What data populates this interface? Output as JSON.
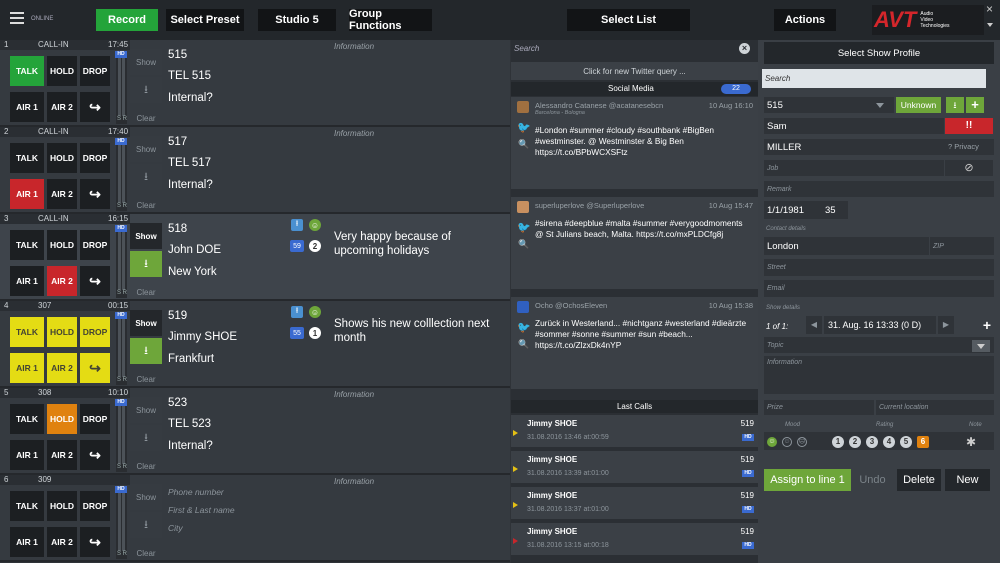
{
  "topbar": {
    "status": "ONLINE",
    "record": "Record",
    "select_preset": "Select Preset",
    "studio": "Studio 5",
    "group_functions": "Group Functions",
    "select_list": "Select List",
    "actions": "Actions",
    "logo": "AVT",
    "logo_sub1": "Audio",
    "logo_sub2": "Video",
    "logo_sub3": "Technologies",
    "close": "×"
  },
  "keys": {
    "talk": "TALK",
    "hold": "HOLD",
    "drop": "DROP",
    "air1": "AIR 1",
    "air2": "AIR 2",
    "show": "Show",
    "clear": "Clear",
    "sr": "S R",
    "hd": "HD"
  },
  "lines": [
    {
      "num": "1",
      "type": "CALL-IN",
      "time": "17:45",
      "f1": "515",
      "f2": "TEL 515",
      "f3": "Internal?",
      "info": "Information"
    },
    {
      "num": "2",
      "type": "CALL-IN",
      "time": "17:40",
      "f1": "517",
      "f2": "TEL 517",
      "f3": "Internal?",
      "info": "Information"
    },
    {
      "num": "3",
      "type": "CALL-IN",
      "time": "16:15",
      "f1": "518",
      "f2": "John DOE",
      "f3": "New York",
      "info": "Very happy because of upcoming holidays",
      "b1": "59",
      "b2": "2"
    },
    {
      "num": "4",
      "type": "307",
      "time": "00:15",
      "f1": "519",
      "f2": "Jimmy SHOE",
      "f3": "Frankfurt",
      "info": "Shows his new colllection next month",
      "b1": "55",
      "b2": "1"
    },
    {
      "num": "5",
      "type": "308",
      "time": "10:10",
      "f1": "523",
      "f2": "TEL 523",
      "f3": "Internal?",
      "info": "Information"
    },
    {
      "num": "6",
      "type": "309",
      "time": "",
      "f1": "Phone number",
      "f2": "First & Last name",
      "f3": "City",
      "info": "Information"
    }
  ],
  "twitter": {
    "search": "Search",
    "query_btn": "Click for new Twitter query ...",
    "social": "Social Media",
    "count": "22",
    "tweets": [
      {
        "user": "Alessandro Catanese  @acatanesebcn",
        "time": "10 Aug 16:10",
        "loc": "Barcelona - Bologna",
        "text": "#London #summer #cloudy #southbank #BigBen #westminster. @ Westminster & Big Ben https://t.co/BPbWCXSFtz"
      },
      {
        "user": "superluperlove  @Superluperlove",
        "time": "10 Aug 15:47",
        "text": "#sirena #deepblue #malta #summer #verygoodmoments @ St Julians beach, Malta. https://t.co/mxPLDCfg8j"
      },
      {
        "user": "Ocho  @OchosEleven",
        "time": "10 Aug 15:38",
        "text": "Zurück in Westerland... #nichtganz #westerland #dieärzte #sommer #sonne #summer #sun #beach... https://t.co/ZlzxDk4nYP"
      }
    ],
    "last_calls_title": "Last Calls",
    "last_calls": [
      {
        "name": "Jimmy SHOE",
        "num": "519",
        "dt": "31.08.2016  13:46   at:00:59"
      },
      {
        "name": "Jimmy SHOE",
        "num": "519",
        "dt": "31.08.2016  13:39   at:01:00"
      },
      {
        "name": "Jimmy SHOE",
        "num": "519",
        "dt": "31.08.2016  13:37   at:01:00"
      },
      {
        "name": "Jimmy SHOE",
        "num": "519",
        "dt": "31.08.2016  13:15   at:00:18"
      }
    ]
  },
  "profile": {
    "title": "Select Show Profile",
    "search": "Search",
    "phone": "515",
    "unknown": "Unknown",
    "first": "Sam",
    "last": "MILLER",
    "privacy": "? Privacy",
    "job": "Job",
    "remark": "Remark",
    "dob": "1/1/1981",
    "age": "35",
    "contact_details": "Contact details",
    "city": "London",
    "zip": "ZIP",
    "street": "Street",
    "email": "Email",
    "show_details": "Show details",
    "of": "1  of  1:",
    "date": "31. Aug. 16  13:33  (0 D)",
    "topic": "Topic",
    "information": "Information",
    "prize": "Prize",
    "current_location": "Current location",
    "mood": "Mood",
    "rating": "Rating",
    "note": "Note",
    "assign": "Assign to line 1",
    "undo": "Undo",
    "delete": "Delete",
    "new": "New",
    "ratings": [
      "1",
      "2",
      "3",
      "4",
      "5",
      "6"
    ]
  },
  "colors": {
    "green": "#24a43a",
    "red": "#c8262b",
    "yellow": "#e4dc14",
    "orange": "#e0820f",
    "blue": "#3a6ad0",
    "olive": "#6ea63a"
  }
}
